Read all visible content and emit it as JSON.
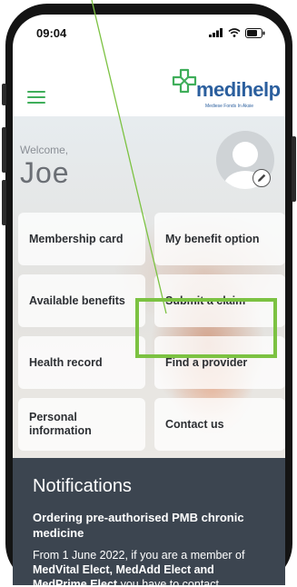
{
  "status_bar": {
    "time": "09:04",
    "icons": [
      "signal-icon",
      "wifi-icon",
      "battery-icon"
    ]
  },
  "header": {
    "menu_icon": "hamburger-menu-icon",
    "logo": {
      "wordmark": "medihelp",
      "tagline": "Mediese Fonds In Aksie"
    }
  },
  "welcome": {
    "greeting": "Welcome,",
    "name": "Joe",
    "avatar_icon": "user-avatar-icon",
    "edit_icon": "pencil-icon"
  },
  "tiles": [
    {
      "label": "Membership card"
    },
    {
      "label": "My benefit option"
    },
    {
      "label": "Available benefits"
    },
    {
      "label": "Submit a claim"
    },
    {
      "label": "Health record"
    },
    {
      "label": "Find a provider"
    },
    {
      "label": "Personal information"
    },
    {
      "label": "Contact us"
    }
  ],
  "notifications": {
    "title": "Notifications",
    "item_heading": "Ordering pre-authorised PMB chronic medicine",
    "body_intro": "From 1 June 2022, if you are a member of ",
    "body_bold": "MedVital Elect, MedAdd Elect and MedPrime Elect",
    "body_rest": " you have to contact"
  },
  "colors": {
    "brand_green": "#3fae5a",
    "brand_blue": "#2b5f9e",
    "highlight_green": "#7cc242",
    "notifications_bg": "#3c4550"
  }
}
